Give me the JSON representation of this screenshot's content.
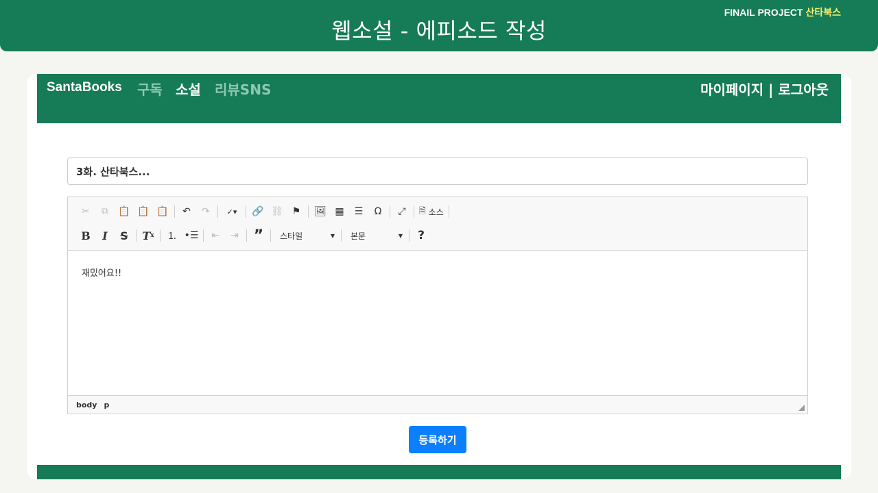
{
  "banner": {
    "title": "웹소설 - 에피소드 작성",
    "project_label": "FINAIL PROJECT",
    "project_name": "산타북스"
  },
  "navbar": {
    "brand": "SantaBooks",
    "links": [
      "구독",
      "소설",
      "리뷰SNS"
    ],
    "mypage": "마이페이지",
    "separator": "|",
    "logout": "로그아웃"
  },
  "form": {
    "title_value": "3화. 산타북스...",
    "editor_content": "재밌어요!!",
    "submit_label": "등록하기"
  },
  "editor": {
    "source_label": "소스",
    "style_combo": "스타일",
    "format_combo": "본문",
    "help_label": "?",
    "path": [
      "body",
      "p"
    ]
  },
  "colors": {
    "brand_green": "#167b57",
    "nav_link_inactive": "#8fc9b2",
    "submit_blue": "#0b7ffe",
    "project_accent": "#f4ee6a"
  }
}
